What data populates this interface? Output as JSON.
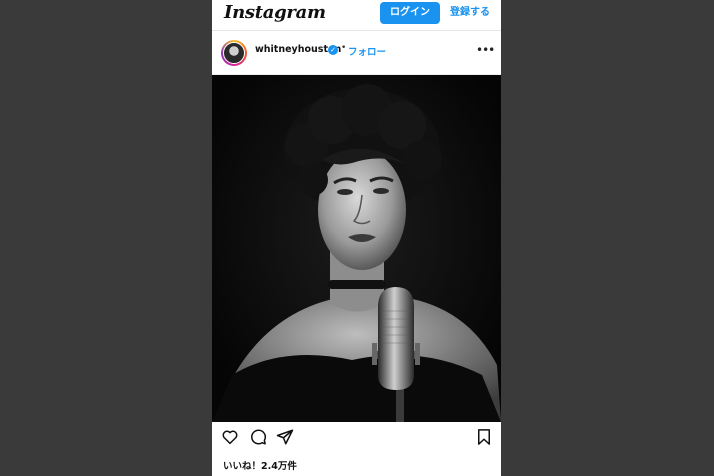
{
  "header": {
    "logo": "Instagram",
    "login_label": "ログイン",
    "signup_label": "登録する"
  },
  "post": {
    "username": "whitneyhouston",
    "separator": "•",
    "follow_label": "フォロー",
    "more_glyph": "•••",
    "likes_text": "いいね！2.4万件"
  },
  "icons": {
    "verified": "verified-badge-icon",
    "like": "heart-icon",
    "comment": "comment-icon",
    "share": "paper-plane-icon",
    "save": "bookmark-icon"
  },
  "colors": {
    "accent": "#1a93f0",
    "background": "#3a3a3a"
  }
}
